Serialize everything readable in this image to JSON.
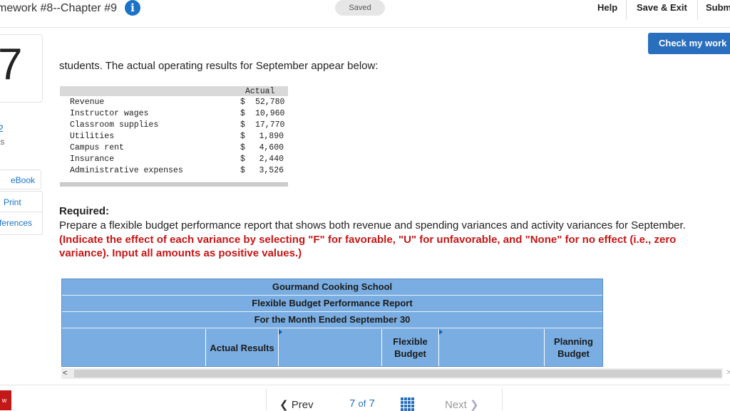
{
  "header": {
    "title": "mework #8--Chapter #9",
    "info_icon": "i",
    "saved": "Saved",
    "help": "Help",
    "save_exit": "Save & Exit",
    "submit": "Subm"
  },
  "sidebar": {
    "question_number": "7",
    "points_value": "2",
    "points_label": "ts",
    "ebook": "eBook",
    "print": "Print",
    "references": "ferences",
    "red_tab": "w"
  },
  "check_button": "Check my work",
  "intro": "students. The actual operating results for September appear below:",
  "data_table": {
    "header": "Actual",
    "rows": [
      {
        "label": "Revenue",
        "currency": "$",
        "amount": "52,780"
      },
      {
        "label": "Instructor wages",
        "currency": "$",
        "amount": "10,960"
      },
      {
        "label": "Classroom supplies",
        "currency": "$",
        "amount": "17,770"
      },
      {
        "label": "Utilities",
        "currency": "$",
        "amount": "1,890"
      },
      {
        "label": "Campus rent",
        "currency": "$",
        "amount": "4,600"
      },
      {
        "label": "Insurance",
        "currency": "$",
        "amount": "2,440"
      },
      {
        "label": "Administrative expenses",
        "currency": "$",
        "amount": "3,526"
      }
    ]
  },
  "required": {
    "heading": "Required:",
    "text": "Prepare a flexible budget performance report that shows both revenue and spending variances and activity variances for September.",
    "instruction": "(Indicate the effect of each variance by selecting \"F\" for favorable, \"U\" for unfavorable, and \"None\" for no effect (i.e., zero variance). Input all amounts as positive values.)"
  },
  "report": {
    "title": "Gourmand Cooking School",
    "subtitle": "Flexible Budget Performance Report",
    "period": "For the Month Ended September 30",
    "columns": [
      "Actual Results",
      "",
      "Flexible Budget",
      "",
      "Planning Budget"
    ]
  },
  "scroll": {
    "left_arrow": "<",
    "right_arrow": ">"
  },
  "footer": {
    "prev": "Prev",
    "page_current": "7",
    "page_of": "of",
    "page_total": "7",
    "next": "Next"
  },
  "colors": {
    "accent": "#2a6fbd",
    "report_bg": "#7aaee2",
    "required_red": "#c41717"
  }
}
